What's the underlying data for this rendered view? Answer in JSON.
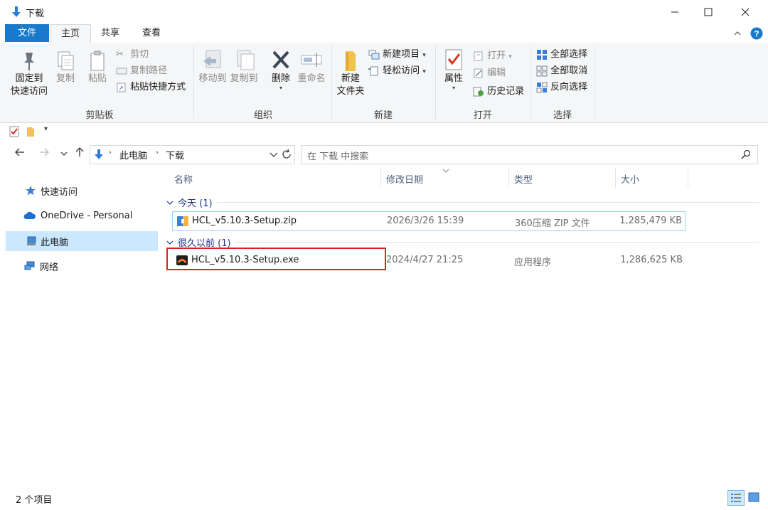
{
  "window": {
    "title": "下载",
    "minimize_symbol": "—",
    "maximize_symbol": "☐",
    "close_symbol": "✕"
  },
  "ribbon_tabs": {
    "file": "文件",
    "home": "主页",
    "share": "共享",
    "view": "查看"
  },
  "ribbon": {
    "clipboard": {
      "label": "剪贴板",
      "pin_line1": "固定到",
      "pin_line2": "快速访问",
      "copy": "复制",
      "paste": "粘贴",
      "cut": "剪切",
      "copy_path": "复制路径",
      "paste_shortcut": "粘贴快捷方式"
    },
    "organize": {
      "label": "组织",
      "move_to": "移动到",
      "copy_to": "复制到",
      "delete": "删除",
      "rename": "重命名"
    },
    "new": {
      "label": "新建",
      "new_folder_line1": "新建",
      "new_folder_line2": "文件夹",
      "new_item": "新建项目",
      "easy_access": "轻松访问"
    },
    "open": {
      "label": "打开",
      "properties": "属性",
      "open": "打开",
      "edit": "编辑",
      "history": "历史记录"
    },
    "select": {
      "label": "选择",
      "select_all": "全部选择",
      "select_none": "全部取消",
      "invert": "反向选择"
    }
  },
  "address": {
    "crumbs": [
      "此电脑",
      "下载"
    ],
    "search_placeholder": "在 下载 中搜索"
  },
  "nav_pane": {
    "items": [
      {
        "label": "快速访问"
      },
      {
        "label": "OneDrive - Personal"
      },
      {
        "label": "此电脑"
      },
      {
        "label": "网络"
      }
    ]
  },
  "columns": {
    "name": "名称",
    "modified": "修改日期",
    "type": "类型",
    "size": "大小"
  },
  "groups": [
    {
      "header": "今天 (1)",
      "files": [
        {
          "name": "HCL_v5.10.3-Setup.zip",
          "modified": "2026/3/26 15:39",
          "type": "360压缩 ZIP 文件",
          "size": "1,285,479 KB"
        }
      ]
    },
    {
      "header": "很久以前 (1)",
      "files": [
        {
          "name": "HCL_v5.10.3-Setup.exe",
          "modified": "2024/4/27 21:25",
          "type": "应用程序",
          "size": "1,286,625 KB"
        }
      ]
    }
  ],
  "status": {
    "item_count": "2 个项目"
  },
  "colors": {
    "accent": "#1979ca",
    "selection": "#cce8ff",
    "highlight_box": "#e02020"
  }
}
